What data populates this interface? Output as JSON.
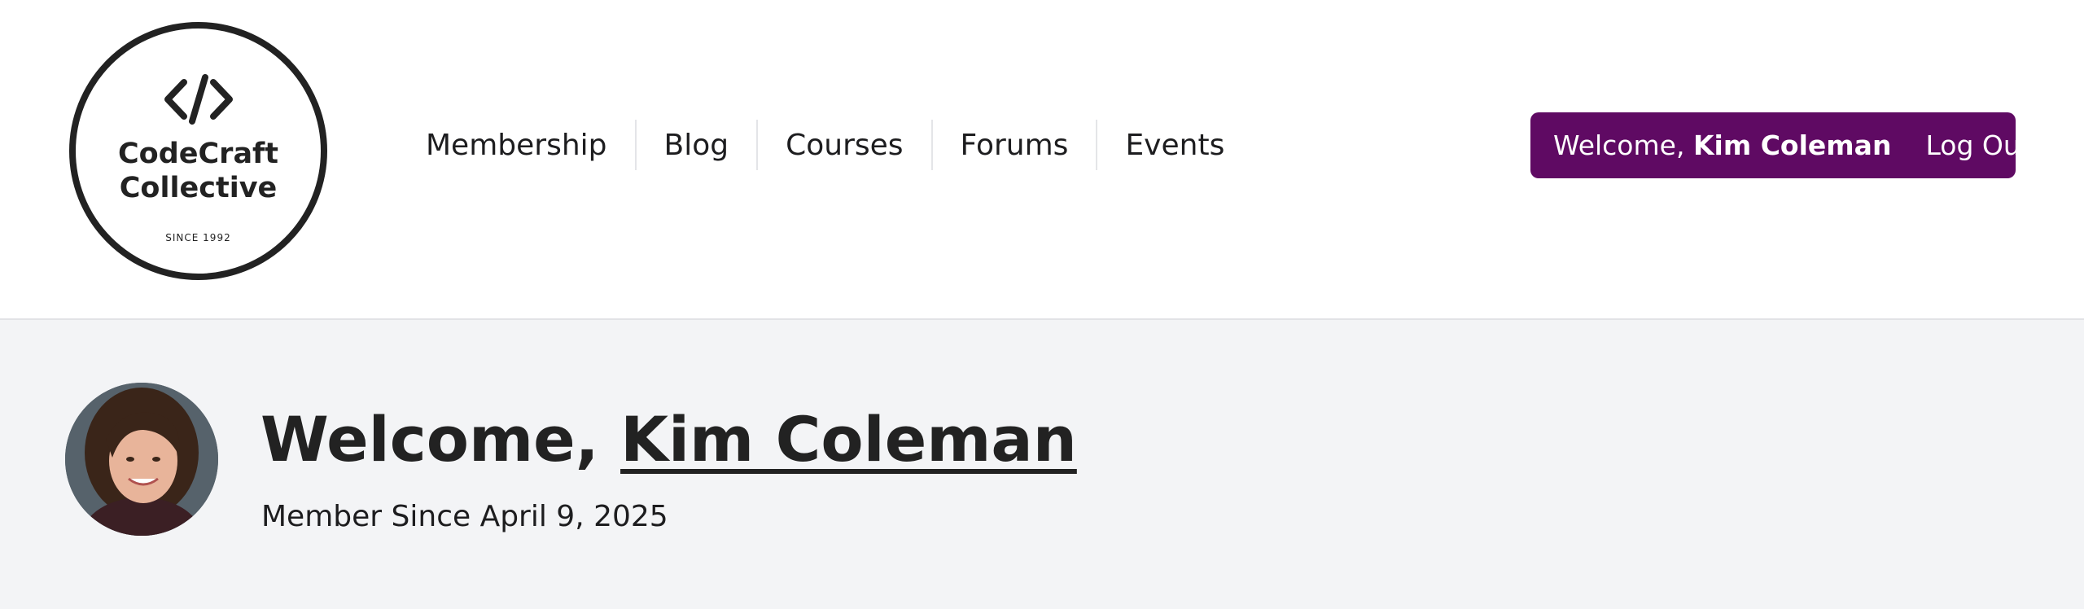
{
  "brand": {
    "name_line1": "CodeCraft",
    "name_line2": "Collective",
    "tagline": "SINCE 1992",
    "icon": "code-brackets-icon"
  },
  "nav": {
    "items": [
      {
        "label": "Membership"
      },
      {
        "label": "Blog"
      },
      {
        "label": "Courses"
      },
      {
        "label": "Forums"
      },
      {
        "label": "Events"
      }
    ]
  },
  "account": {
    "welcome_prefix": "Welcome,",
    "user_name": "Kim Coleman",
    "logout_label": "Log Out",
    "accent_color": "#5f0a63"
  },
  "profile": {
    "heading_prefix": "Welcome,",
    "user_name": "Kim Coleman",
    "member_since": "Member Since April 9, 2025"
  }
}
